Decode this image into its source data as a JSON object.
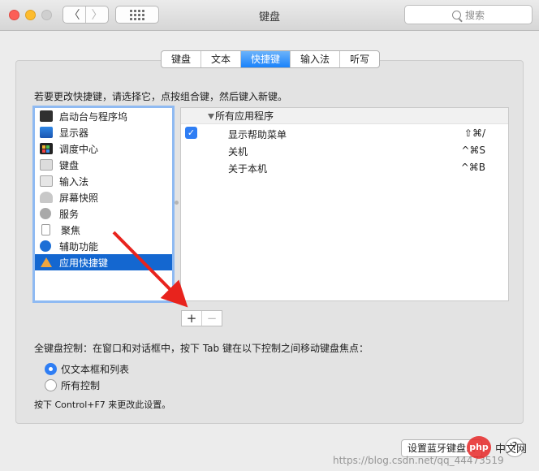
{
  "window": {
    "title": "键盘",
    "search_placeholder": "搜索",
    "back_glyph": "〈",
    "forward_glyph": "〉"
  },
  "tabs": [
    {
      "label": "键盘",
      "active": false
    },
    {
      "label": "文本",
      "active": false
    },
    {
      "label": "快捷键",
      "active": true
    },
    {
      "label": "输入法",
      "active": false
    },
    {
      "label": "听写",
      "active": false
    }
  ],
  "hint": "若要更改快捷键，请选择它，点按组合键，然后键入新键。",
  "categories": [
    {
      "label": "启动台与程序坞",
      "icon": "launchpad-icon"
    },
    {
      "label": "显示器",
      "icon": "display-icon"
    },
    {
      "label": "调度中心",
      "icon": "mission-control-icon"
    },
    {
      "label": "键盘",
      "icon": "keyboard-icon"
    },
    {
      "label": "输入法",
      "icon": "input-source-icon"
    },
    {
      "label": "屏幕快照",
      "icon": "screenshot-icon"
    },
    {
      "label": "服务",
      "icon": "gear-icon"
    },
    {
      "label": "聚焦",
      "icon": "spotlight-icon"
    },
    {
      "label": "辅助功能",
      "icon": "accessibility-icon"
    },
    {
      "label": "应用快捷键",
      "icon": "app-store-icon",
      "selected": true
    }
  ],
  "shortcuts": {
    "group": "所有应用程序",
    "rows": [
      {
        "label": "显示帮助菜单",
        "key": "⇧⌘/",
        "checked": true
      },
      {
        "label": "关机",
        "key": "^⌘S",
        "checked": false
      },
      {
        "label": "关于本机",
        "key": "^⌘B",
        "checked": false
      }
    ]
  },
  "controls": {
    "add": "+",
    "remove": "−",
    "check_glyph": "✓"
  },
  "full_keyboard": {
    "label": "全键盘控制：在窗口和对话框中，按下 Tab 键在以下控制之间移动键盘焦点：",
    "options": [
      {
        "label": "仅文本框和列表",
        "selected": true
      },
      {
        "label": "所有控制",
        "selected": false
      }
    ],
    "note": "按下 Control+F7 来更改此设置。"
  },
  "bluetooth_button": "设置蓝牙键盘…",
  "help_glyph": "?",
  "watermark": {
    "url": "https://blog.csdn.net/qq_44473519",
    "logo": "php",
    "text": "中文网"
  },
  "colors": {
    "accent": "#1a82fb",
    "selection": "#1467d0",
    "arrow": "#e8231d"
  }
}
